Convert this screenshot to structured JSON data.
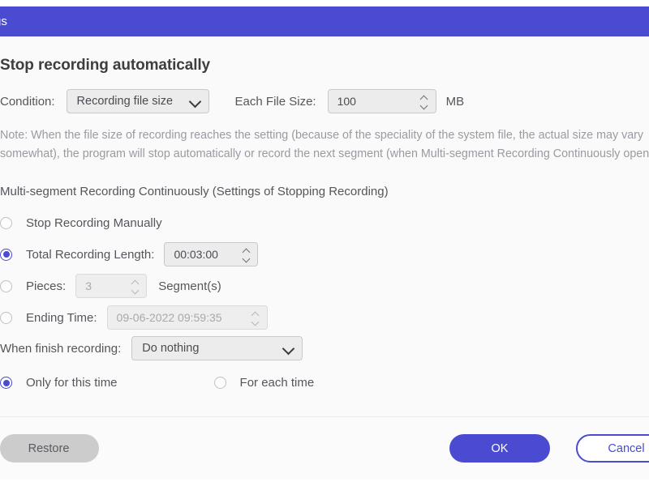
{
  "window": {
    "title": "Settings",
    "titlebar_color": "#4a4bd0",
    "background": "#fafafa"
  },
  "heading": "Stop recording automatically",
  "condition_row": {
    "label": "Condition:",
    "select_value": "Recording file size",
    "chevron_icon": "chevron-down-icon",
    "size_label": "Each File Size:",
    "size_value": "100",
    "size_unit": "MB",
    "spinner_up_icon": "chevron-up-icon",
    "spinner_down_icon": "chevron-down-icon"
  },
  "note": "Note: When the file size of recording reaches the setting (because of the speciality of the system file, the actual size may vary somewhat), the program will stop automatically or record the next segment (when Multi-segment Recording Continuously opens).",
  "multi_segment": {
    "subheading": "Multi-segment Recording Continuously (Settings of Stopping Recording)",
    "options": [
      {
        "label": "Stop Recording Manually",
        "checked": false,
        "field": null
      },
      {
        "label": "Total Recording Length:",
        "checked": true,
        "field": {
          "value": "00:03:00",
          "disabled": false,
          "suffix": ""
        }
      },
      {
        "label": "Pieces:",
        "checked": false,
        "field": {
          "value": "3",
          "disabled": true,
          "suffix": "Segment(s)"
        }
      },
      {
        "label": "Ending Time:",
        "checked": false,
        "field": {
          "value": "09-06-2022 09:59:35",
          "disabled": true,
          "suffix": ""
        }
      }
    ]
  },
  "finish_row": {
    "label": "When finish recording:",
    "select_value": "Do nothing",
    "chevron_icon": "chevron-down-icon"
  },
  "scope_row": {
    "only_this_time": "Only for this time",
    "only_this_time_checked": true,
    "for_each_time": "For each time",
    "for_each_time_checked": false
  },
  "footer": {
    "restore_label": "Restore",
    "ok_label": "OK",
    "cancel_label": "Cancel",
    "ok_color": "#4a4bd0",
    "restore_color": "#cccccc"
  }
}
